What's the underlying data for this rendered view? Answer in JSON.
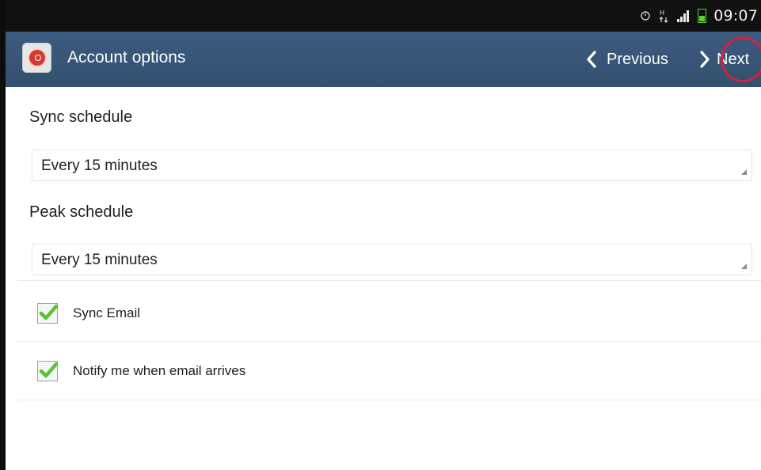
{
  "status_bar": {
    "time": "09:07",
    "icons": [
      "alarm-icon",
      "data-transfer-icon",
      "signal-icon",
      "battery-icon"
    ]
  },
  "action_bar": {
    "title": "Account options",
    "app_icon": "email-app-icon",
    "previous_label": "Previous",
    "next_label": "Next"
  },
  "sync_schedule": {
    "label": "Sync schedule",
    "value": "Every 15 minutes"
  },
  "peak_schedule": {
    "label": "Peak schedule",
    "value": "Every 15 minutes"
  },
  "options": [
    {
      "label": "Sync Email",
      "checked": true
    },
    {
      "label": "Notify me when email arrives",
      "checked": true
    }
  ],
  "colors": {
    "action_bar": "#3a5778",
    "status_bar": "#111111",
    "checkmark": "#5bc236",
    "highlight_ring": "#d2233f"
  }
}
